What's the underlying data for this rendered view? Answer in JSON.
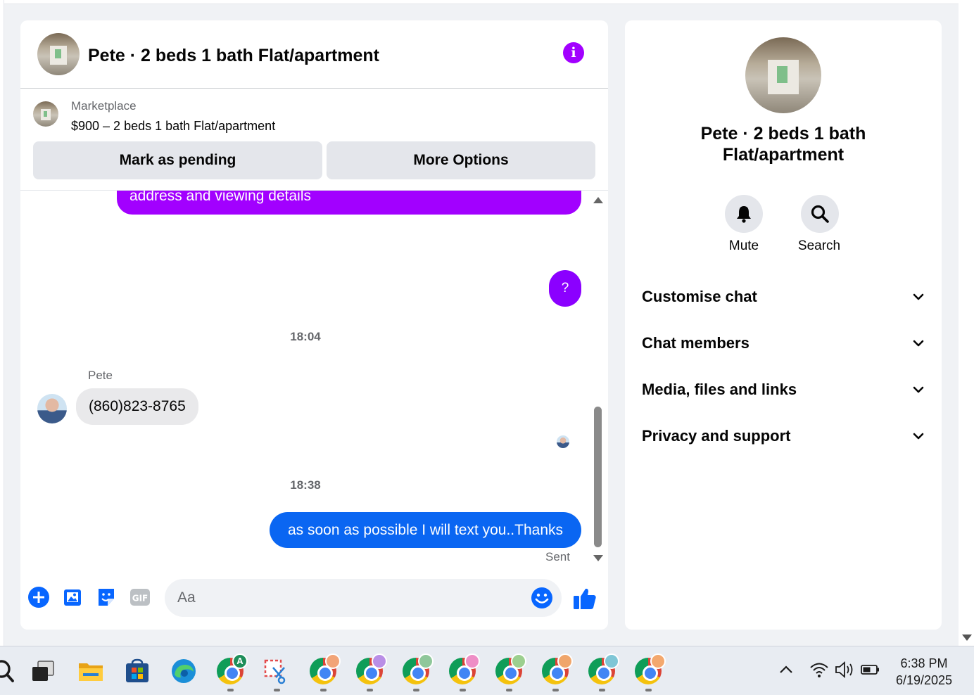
{
  "chat": {
    "title": "Pete · 2 beds 1 bath Flat/apartment",
    "marketplace_label": "Marketplace",
    "listing": "$900 – 2 beds 1 bath Flat/apartment",
    "buttons": {
      "mark_pending": "Mark as pending",
      "more_options": "More Options"
    },
    "messages": {
      "partial_outgoing": "address and viewing details",
      "question_bubble": "?",
      "timestamp_1": "18:04",
      "sender": "Pete",
      "incoming": "(860)823-8765",
      "timestamp_2": "18:38",
      "outgoing": "as soon as possible I will text you..Thanks",
      "status": "Sent"
    },
    "composer": {
      "placeholder": "Aa"
    }
  },
  "info": {
    "title": "Pete · 2 beds 1 bath Flat/apartment",
    "actions": {
      "mute": "Mute",
      "search": "Search"
    },
    "sections": [
      "Customise chat",
      "Chat members",
      "Media, files and links",
      "Privacy and support"
    ]
  },
  "taskbar": {
    "time": "6:38 PM",
    "date": "6/19/2025",
    "first_chrome_badge": "A"
  },
  "colors": {
    "accent_purple": "#a200ff",
    "accent_blue": "#0a66f2",
    "icon_blue": "#0866ff"
  }
}
